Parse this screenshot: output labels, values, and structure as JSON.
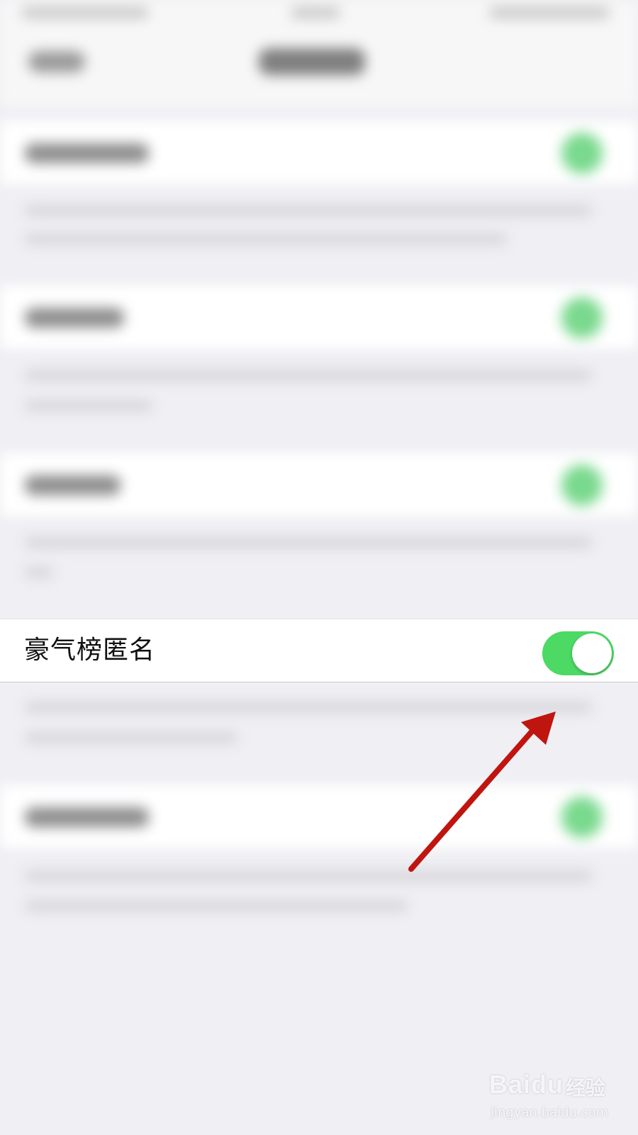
{
  "setting_row": {
    "label": "豪气榜匿名",
    "toggle_on": true
  },
  "colors": {
    "toggle_on": "#4cd964",
    "background": "#efeff4",
    "arrow": "#c0150f"
  },
  "watermark": {
    "brand": "Baidu",
    "product": "经验",
    "url": "jingyan.baidu.com"
  }
}
